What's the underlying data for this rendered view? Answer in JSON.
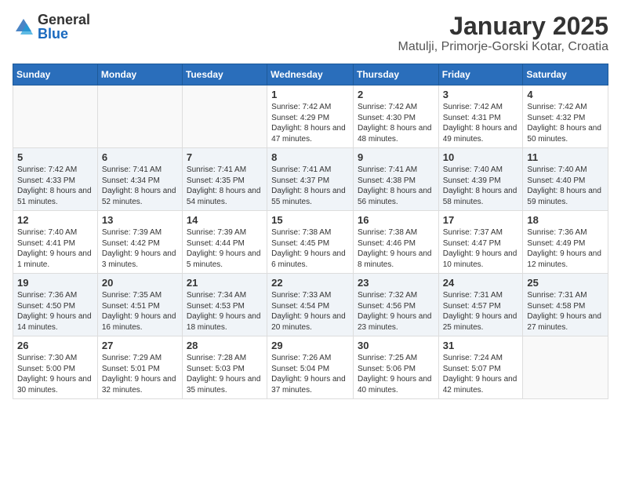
{
  "logo": {
    "general": "General",
    "blue": "Blue"
  },
  "header": {
    "month": "January 2025",
    "location": "Matulji, Primorje-Gorski Kotar, Croatia"
  },
  "weekdays": [
    "Sunday",
    "Monday",
    "Tuesday",
    "Wednesday",
    "Thursday",
    "Friday",
    "Saturday"
  ],
  "weeks": [
    [
      {
        "day": "",
        "info": ""
      },
      {
        "day": "",
        "info": ""
      },
      {
        "day": "",
        "info": ""
      },
      {
        "day": "1",
        "info": "Sunrise: 7:42 AM\nSunset: 4:29 PM\nDaylight: 8 hours and 47 minutes."
      },
      {
        "day": "2",
        "info": "Sunrise: 7:42 AM\nSunset: 4:30 PM\nDaylight: 8 hours and 48 minutes."
      },
      {
        "day": "3",
        "info": "Sunrise: 7:42 AM\nSunset: 4:31 PM\nDaylight: 8 hours and 49 minutes."
      },
      {
        "day": "4",
        "info": "Sunrise: 7:42 AM\nSunset: 4:32 PM\nDaylight: 8 hours and 50 minutes."
      }
    ],
    [
      {
        "day": "5",
        "info": "Sunrise: 7:42 AM\nSunset: 4:33 PM\nDaylight: 8 hours and 51 minutes."
      },
      {
        "day": "6",
        "info": "Sunrise: 7:41 AM\nSunset: 4:34 PM\nDaylight: 8 hours and 52 minutes."
      },
      {
        "day": "7",
        "info": "Sunrise: 7:41 AM\nSunset: 4:35 PM\nDaylight: 8 hours and 54 minutes."
      },
      {
        "day": "8",
        "info": "Sunrise: 7:41 AM\nSunset: 4:37 PM\nDaylight: 8 hours and 55 minutes."
      },
      {
        "day": "9",
        "info": "Sunrise: 7:41 AM\nSunset: 4:38 PM\nDaylight: 8 hours and 56 minutes."
      },
      {
        "day": "10",
        "info": "Sunrise: 7:40 AM\nSunset: 4:39 PM\nDaylight: 8 hours and 58 minutes."
      },
      {
        "day": "11",
        "info": "Sunrise: 7:40 AM\nSunset: 4:40 PM\nDaylight: 8 hours and 59 minutes."
      }
    ],
    [
      {
        "day": "12",
        "info": "Sunrise: 7:40 AM\nSunset: 4:41 PM\nDaylight: 9 hours and 1 minute."
      },
      {
        "day": "13",
        "info": "Sunrise: 7:39 AM\nSunset: 4:42 PM\nDaylight: 9 hours and 3 minutes."
      },
      {
        "day": "14",
        "info": "Sunrise: 7:39 AM\nSunset: 4:44 PM\nDaylight: 9 hours and 5 minutes."
      },
      {
        "day": "15",
        "info": "Sunrise: 7:38 AM\nSunset: 4:45 PM\nDaylight: 9 hours and 6 minutes."
      },
      {
        "day": "16",
        "info": "Sunrise: 7:38 AM\nSunset: 4:46 PM\nDaylight: 9 hours and 8 minutes."
      },
      {
        "day": "17",
        "info": "Sunrise: 7:37 AM\nSunset: 4:47 PM\nDaylight: 9 hours and 10 minutes."
      },
      {
        "day": "18",
        "info": "Sunrise: 7:36 AM\nSunset: 4:49 PM\nDaylight: 9 hours and 12 minutes."
      }
    ],
    [
      {
        "day": "19",
        "info": "Sunrise: 7:36 AM\nSunset: 4:50 PM\nDaylight: 9 hours and 14 minutes."
      },
      {
        "day": "20",
        "info": "Sunrise: 7:35 AM\nSunset: 4:51 PM\nDaylight: 9 hours and 16 minutes."
      },
      {
        "day": "21",
        "info": "Sunrise: 7:34 AM\nSunset: 4:53 PM\nDaylight: 9 hours and 18 minutes."
      },
      {
        "day": "22",
        "info": "Sunrise: 7:33 AM\nSunset: 4:54 PM\nDaylight: 9 hours and 20 minutes."
      },
      {
        "day": "23",
        "info": "Sunrise: 7:32 AM\nSunset: 4:56 PM\nDaylight: 9 hours and 23 minutes."
      },
      {
        "day": "24",
        "info": "Sunrise: 7:31 AM\nSunset: 4:57 PM\nDaylight: 9 hours and 25 minutes."
      },
      {
        "day": "25",
        "info": "Sunrise: 7:31 AM\nSunset: 4:58 PM\nDaylight: 9 hours and 27 minutes."
      }
    ],
    [
      {
        "day": "26",
        "info": "Sunrise: 7:30 AM\nSunset: 5:00 PM\nDaylight: 9 hours and 30 minutes."
      },
      {
        "day": "27",
        "info": "Sunrise: 7:29 AM\nSunset: 5:01 PM\nDaylight: 9 hours and 32 minutes."
      },
      {
        "day": "28",
        "info": "Sunrise: 7:28 AM\nSunset: 5:03 PM\nDaylight: 9 hours and 35 minutes."
      },
      {
        "day": "29",
        "info": "Sunrise: 7:26 AM\nSunset: 5:04 PM\nDaylight: 9 hours and 37 minutes."
      },
      {
        "day": "30",
        "info": "Sunrise: 7:25 AM\nSunset: 5:06 PM\nDaylight: 9 hours and 40 minutes."
      },
      {
        "day": "31",
        "info": "Sunrise: 7:24 AM\nSunset: 5:07 PM\nDaylight: 9 hours and 42 minutes."
      },
      {
        "day": "",
        "info": ""
      }
    ]
  ]
}
